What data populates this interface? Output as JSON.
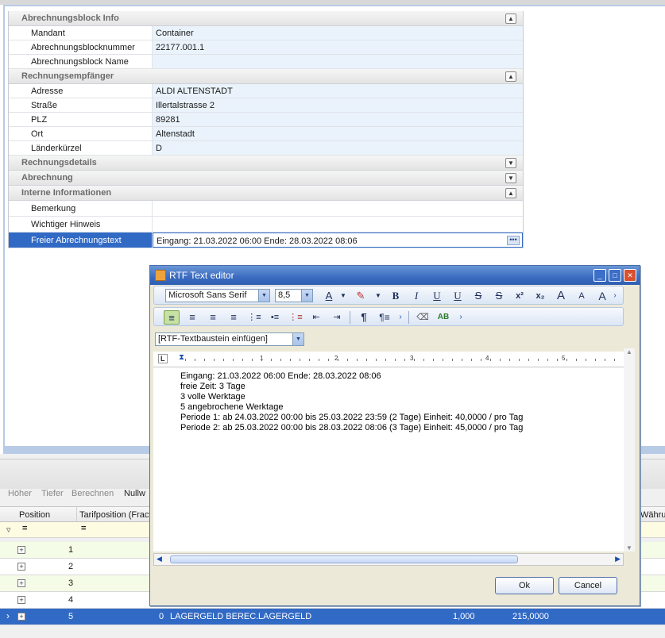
{
  "property_grid": {
    "cat1": "Abrechnungsblock Info",
    "mandant_k": "Mandant",
    "mandant_v": "Container",
    "nummer_k": "Abrechnungsblocknummer",
    "nummer_v": "22177.001.1",
    "name_k": "Abrechnungsblock Name",
    "name_v": "",
    "cat2": "Rechnungsempfänger",
    "adresse_k": "Adresse",
    "adresse_v": "ALDI ALTENSTADT",
    "strasse_k": "Straße",
    "strasse_v": "Illertalstrasse 2",
    "plz_k": "PLZ",
    "plz_v": "89281",
    "ort_k": "Ort",
    "ort_v": "Altenstadt",
    "land_k": "Länderkürzel",
    "land_v": "D",
    "cat3": "Rechnungsdetails",
    "cat4": "Abrechnung",
    "cat5": "Interne Informationen",
    "bem_k": "Bemerkung",
    "bem_v": "",
    "hinweis_k": "Wichtiger Hinweis",
    "hinweis_v": "",
    "frei_k": "Freier Abrechnungstext",
    "frei_v": "Eingang: 21.03.2022 06:00 Ende: 28.03.2022 08:06"
  },
  "toolbar": {
    "hoeher": "Höher",
    "tiefer": "Tiefer",
    "berechnen": "Berechnen",
    "nullw": "Nullw"
  },
  "grid": {
    "col_position": "Position",
    "col_tarif": "Tarifposition (Fract",
    "col_waehrung": "Währur",
    "filter_symbol": "=",
    "rows": [
      {
        "pos": "1"
      },
      {
        "pos": "2"
      },
      {
        "pos": "3"
      },
      {
        "pos": "4"
      }
    ],
    "sel_row": {
      "pos": "5",
      "tarif": "0",
      "c3": "LAGERGELD BEREC...",
      "c4": "LAGERGELD",
      "menge": "1,000",
      "betrag": "215,0000"
    }
  },
  "dialog": {
    "title": "RTF Text editor",
    "font": "Microsoft Sans Serif",
    "size": "8,5",
    "textbaustein": "[RTF-Textbaustein einfügen]",
    "lines": [
      "Eingang: 21.03.2022 06:00 Ende: 28.03.2022 08:06",
      "freie Zeit: 3 Tage",
      "3 volle Werktage",
      "5 angebrochene Werktage",
      "Periode 1: ab 24.03.2022 00:00 bis 25.03.2022 23:59 (2 Tage) Einheit: 40,0000 / pro Tag",
      "Periode 2: ab 25.03.2022 00:00 bis 28.03.2022 08:06 (3 Tage) Einheit: 45,0000 / pro Tag"
    ],
    "ok": "Ok",
    "cancel": "Cancel",
    "ruler": [
      "1",
      "2",
      "3",
      "4",
      "5"
    ]
  }
}
